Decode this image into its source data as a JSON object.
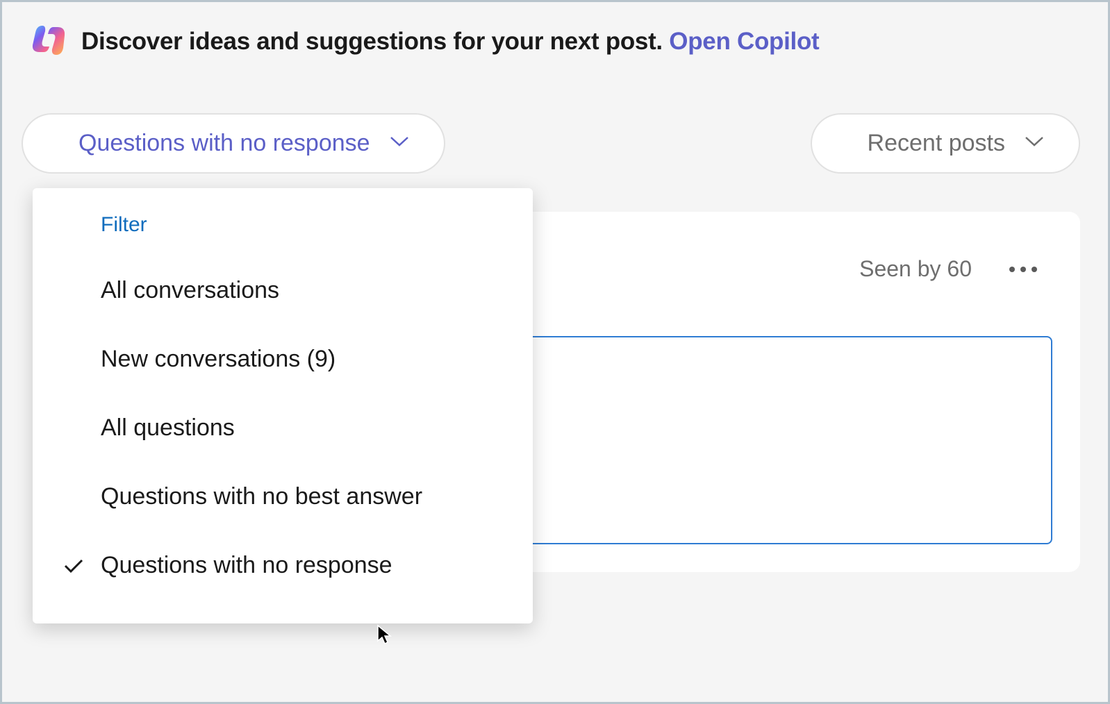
{
  "banner": {
    "text": "Discover ideas and suggestions for your next post. ",
    "link": "Open Copilot"
  },
  "controls": {
    "filter_dropdown_label": "Questions with no response",
    "sort_dropdown_label": "Recent posts"
  },
  "filter_menu": {
    "heading": "Filter",
    "items": [
      {
        "label": "All conversations",
        "selected": false
      },
      {
        "label": "New conversations (9)",
        "selected": false
      },
      {
        "label": "All questions",
        "selected": false
      },
      {
        "label": "Questions with no best answer",
        "selected": false
      },
      {
        "label": "Questions with no response",
        "selected": true
      }
    ]
  },
  "post": {
    "seen_by": "Seen by 60"
  }
}
